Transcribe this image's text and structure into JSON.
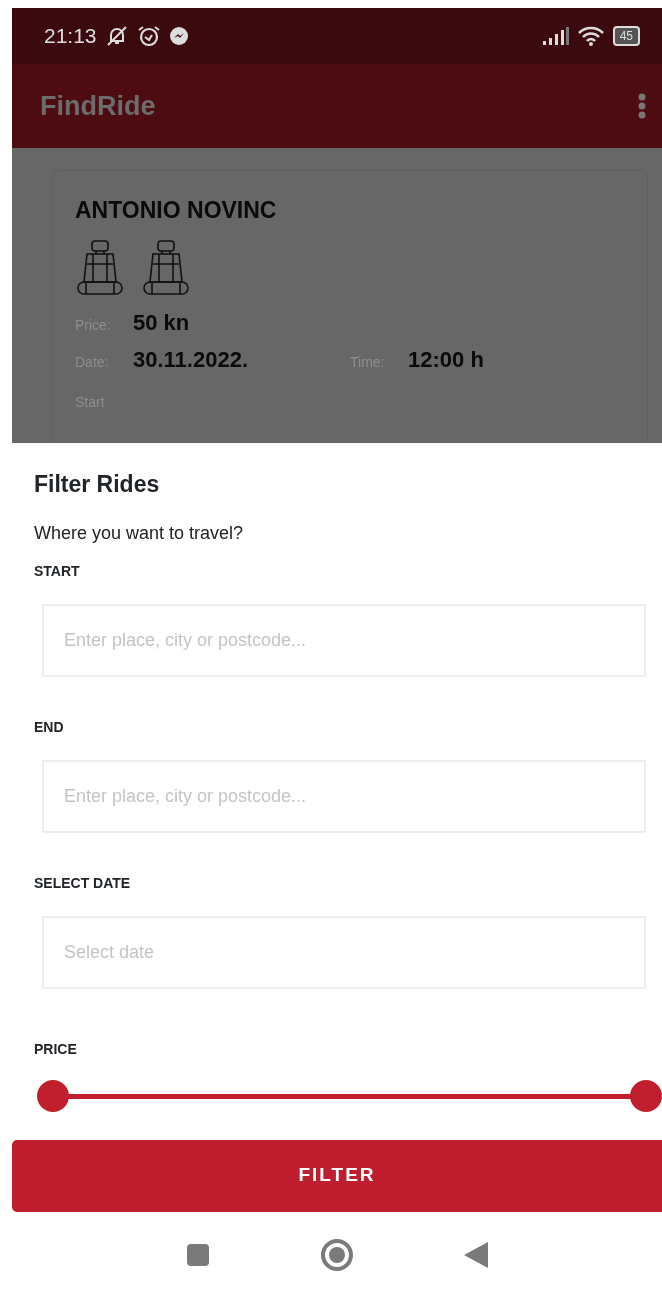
{
  "status_bar": {
    "time": "21:13",
    "battery": "45"
  },
  "app_bar": {
    "title": "FindRide"
  },
  "ride_card": {
    "driver": "ANTONIO NOVINC",
    "fields": [
      {
        "label": "Price:",
        "value": "50 kn"
      },
      {
        "label": "Date:",
        "value": "30.11.2022."
      },
      {
        "label": "Time:",
        "value": "12:00 h"
      }
    ],
    "next_label": "Start"
  },
  "filter_sheet": {
    "title": "Filter Rides",
    "subtitle": "Where you want to travel?",
    "inputs": [
      {
        "label": "START",
        "placeholder": "Enter place, city or postcode..."
      },
      {
        "label": "END",
        "placeholder": "Enter place, city or postcode..."
      },
      {
        "label": "SELECT DATE",
        "placeholder": "Select date"
      }
    ],
    "price": {
      "label": "PRICE",
      "thumbs": [
        {
          "level": 0
        },
        {
          "level": 1
        }
      ]
    },
    "button": "FILTER"
  }
}
